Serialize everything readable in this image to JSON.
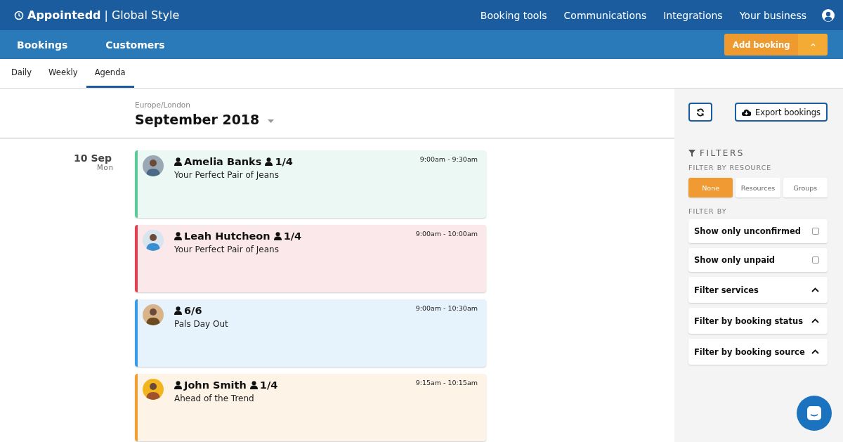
{
  "header": {
    "brand": "Appointedd",
    "separator": "|",
    "business": "Global Style",
    "nav": [
      "Booking tools",
      "Communications",
      "Integrations",
      "Your business"
    ]
  },
  "subnav": {
    "items": [
      "Bookings",
      "Customers"
    ],
    "add_button": "Add booking"
  },
  "view_tabs": [
    {
      "label": "Daily",
      "selected": false
    },
    {
      "label": "Weekly",
      "selected": false
    },
    {
      "label": "Agenda",
      "selected": true
    }
  ],
  "agenda": {
    "timezone": "Europe/London",
    "month": "September 2018",
    "day": {
      "date": "10 Sep",
      "weekday": "Mon"
    },
    "bookings": [
      {
        "customer": "Amelia Banks",
        "count": "1/4",
        "service": "Your Perfect Pair of Jeans",
        "time": "9:00am - 9:30am",
        "color": "#5cc99a"
      },
      {
        "customer": "Leah Hutcheon",
        "count": "1/4",
        "service": "Your Perfect Pair of Jeans",
        "time": "9:00am - 10:00am",
        "color": "#e0404f"
      },
      {
        "count": "6/6",
        "service": "Pals Day Out",
        "time": "9:00am - 10:30am",
        "color": "#3a9be8"
      },
      {
        "customer": "John Smith",
        "count": "1/4",
        "service": "Ahead of the Trend",
        "time": "9:15am - 10:15am",
        "color": "#f0a030"
      }
    ]
  },
  "sidebar": {
    "export_button": "Export bookings",
    "filters_title": "FILTERS",
    "resource_label": "FILTER BY RESOURCE",
    "resource_options": [
      {
        "label": "None",
        "selected": true
      },
      {
        "label": "Resources",
        "selected": false
      },
      {
        "label": "Groups",
        "selected": false
      }
    ],
    "filter_by_label": "FILTER BY",
    "filters": [
      {
        "kind": "checkbox",
        "label": "Show only unconfirmed",
        "checked": false
      },
      {
        "kind": "checkbox",
        "label": "Show only unpaid",
        "checked": false
      },
      {
        "kind": "section",
        "label": "Filter services",
        "expanded": true
      },
      {
        "kind": "section",
        "label": "Filter by booking status",
        "expanded": true
      },
      {
        "kind": "section",
        "label": "Filter by booking source",
        "expanded": true
      }
    ]
  }
}
